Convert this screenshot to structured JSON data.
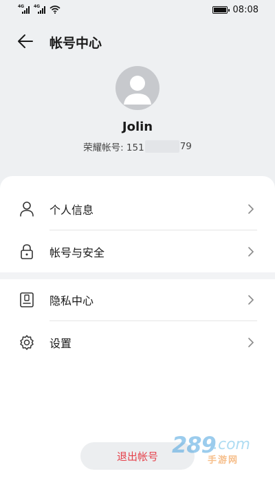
{
  "status_bar": {
    "signal_1": "4G",
    "signal_2": "4G",
    "time": "08:08"
  },
  "header": {
    "back_icon": "arrow-left-icon",
    "title": "帐号中心"
  },
  "profile": {
    "avatar_icon": "user-avatar-placeholder",
    "username": "Jolin",
    "account_label": "荣耀帐号: 151",
    "account_suffix": "79"
  },
  "menu": [
    {
      "label": "个人信息",
      "icon": "person-icon"
    },
    {
      "label": "帐号与安全",
      "icon": "lock-icon"
    },
    {
      "label": "隐私中心",
      "icon": "privacy-card-icon"
    },
    {
      "label": "设置",
      "icon": "gear-icon"
    }
  ],
  "logout": {
    "label": "退出帐号"
  },
  "watermark": {
    "brand": "289",
    "domain": ".com",
    "sub": "手游网"
  },
  "colors": {
    "background": "#eef0f2",
    "card": "#ffffff",
    "logout_text": "#e5404a",
    "avatar": "#c7c9cd"
  }
}
